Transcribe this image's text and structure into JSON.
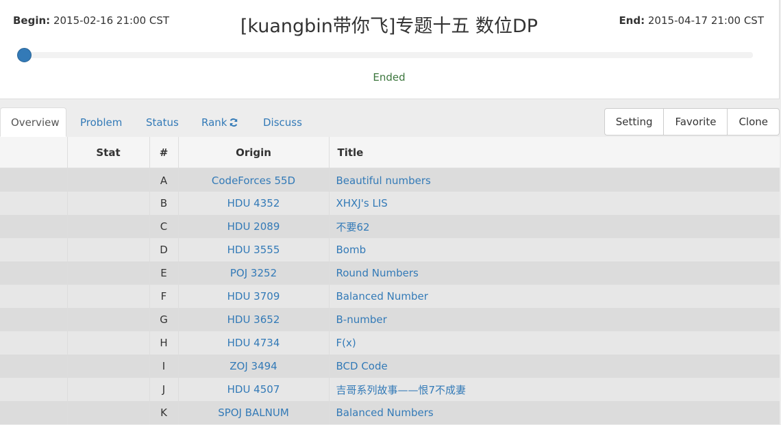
{
  "contest": {
    "begin_label": "Begin:",
    "begin_value": "2015-02-16 21:00 CST",
    "end_label": "End:",
    "end_value": "2015-04-17 21:00 CST",
    "title": "[kuangbin带你飞]专题十五 数位DP",
    "status": "Ended",
    "progress_fraction": 0
  },
  "tabs": [
    {
      "label": "Overview",
      "active": true
    },
    {
      "label": "Problem"
    },
    {
      "label": "Status"
    },
    {
      "label": "Rank",
      "icon": "refresh-icon"
    },
    {
      "label": "Discuss"
    }
  ],
  "buttons": [
    {
      "label": "Setting"
    },
    {
      "label": "Favorite"
    },
    {
      "label": "Clone"
    }
  ],
  "table": {
    "headers": [
      "",
      "Stat",
      "#",
      "Origin",
      "Title"
    ],
    "rows": [
      {
        "num": "A",
        "origin": "CodeForces 55D",
        "title": "Beautiful numbers"
      },
      {
        "num": "B",
        "origin": "HDU 4352",
        "title": "XHXJ's LIS"
      },
      {
        "num": "C",
        "origin": "HDU 2089",
        "title": "不要62"
      },
      {
        "num": "D",
        "origin": "HDU 3555",
        "title": "Bomb"
      },
      {
        "num": "E",
        "origin": "POJ 3252",
        "title": "Round Numbers"
      },
      {
        "num": "F",
        "origin": "HDU 3709",
        "title": "Balanced Number"
      },
      {
        "num": "G",
        "origin": "HDU 3652",
        "title": "B-number"
      },
      {
        "num": "H",
        "origin": "HDU 4734",
        "title": "F(x)"
      },
      {
        "num": "I",
        "origin": "ZOJ 3494",
        "title": "BCD Code"
      },
      {
        "num": "J",
        "origin": "HDU 4507",
        "title": "吉哥系列故事——恨7不成妻"
      },
      {
        "num": "K",
        "origin": "SPOJ BALNUM",
        "title": "Balanced Numbers"
      }
    ]
  },
  "colors": {
    "link": "#337ab7",
    "status": "#3c763d",
    "knob": "#337ab7"
  }
}
